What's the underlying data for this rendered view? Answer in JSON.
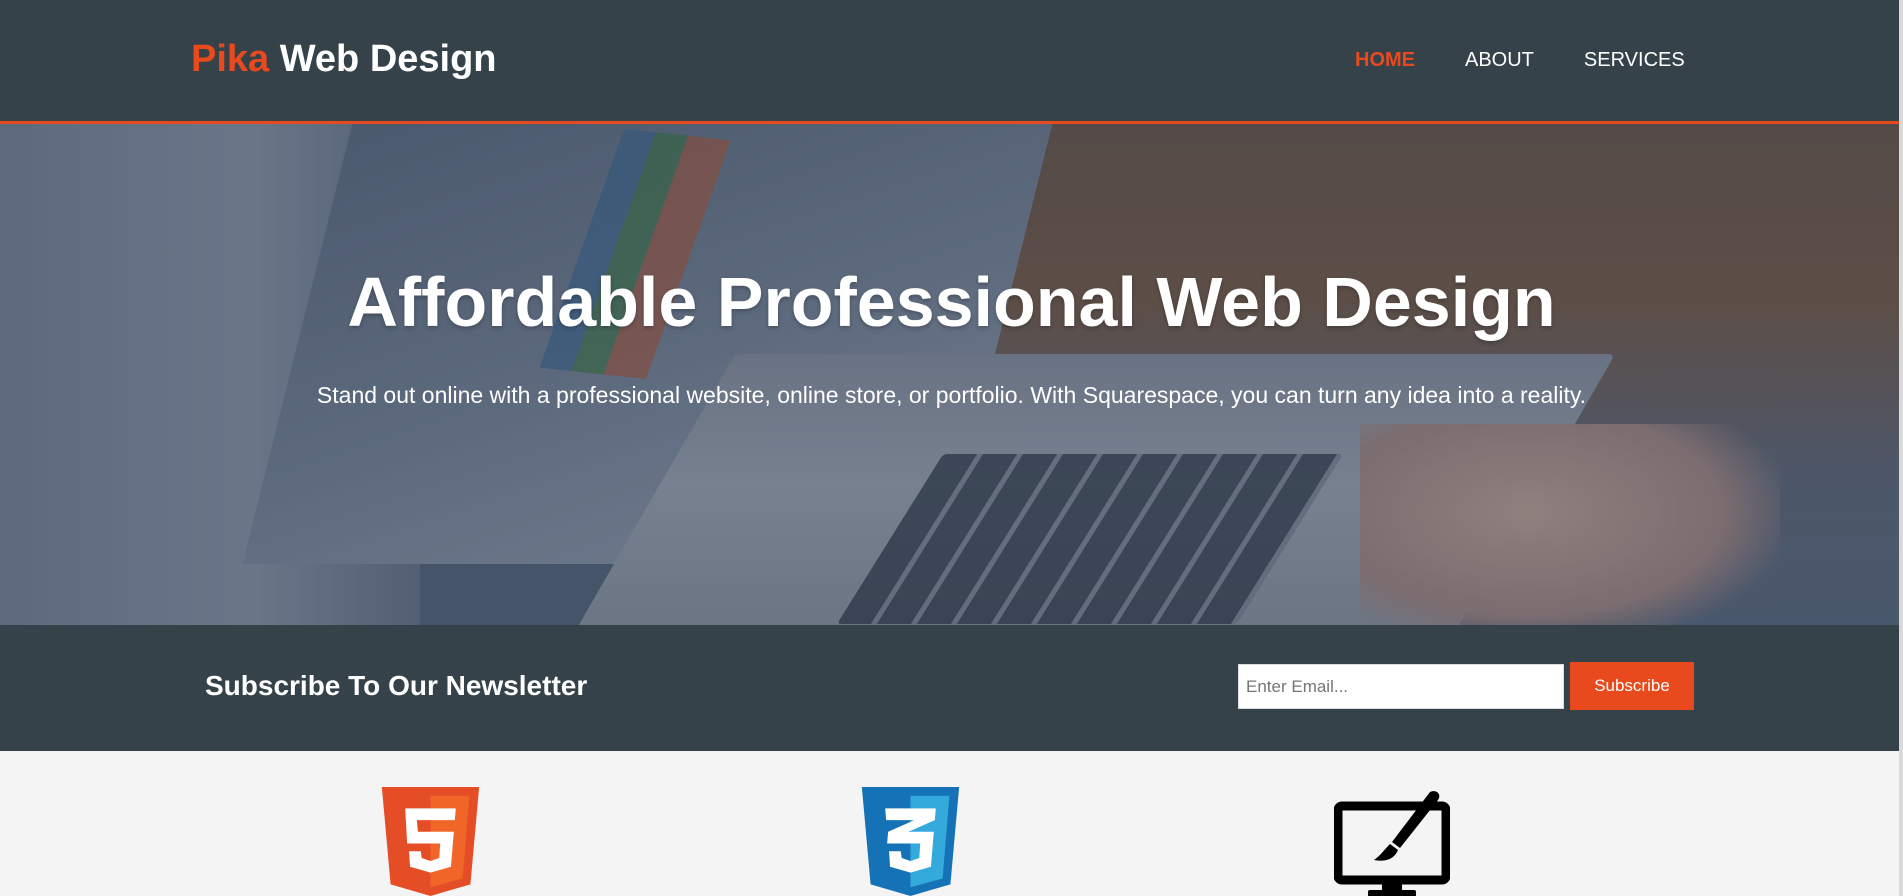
{
  "header": {
    "brand_highlight": "Pika",
    "brand_rest": " Web Design",
    "nav": [
      {
        "label": "HOME",
        "active": true
      },
      {
        "label": "ABOUT",
        "active": false
      },
      {
        "label": "SERVICES",
        "active": false
      }
    ]
  },
  "showcase": {
    "title": "Affordable Professional Web Design",
    "subtitle": "Stand out online with a professional website, online store, or portfolio. With Squarespace, you can turn any idea into a reality."
  },
  "newsletter": {
    "heading": "Subscribe To Our Newsletter",
    "email_placeholder": "Enter Email...",
    "button_label": "Subscribe"
  },
  "boxes": [
    {
      "icon": "html5-icon"
    },
    {
      "icon": "css3-icon"
    },
    {
      "icon": "brush-monitor-icon"
    }
  ],
  "colors": {
    "accent": "#e8491d",
    "dark": "#35424a",
    "light_bg": "#f4f4f4",
    "html5": "#e44d26",
    "css3": "#1572b6"
  }
}
